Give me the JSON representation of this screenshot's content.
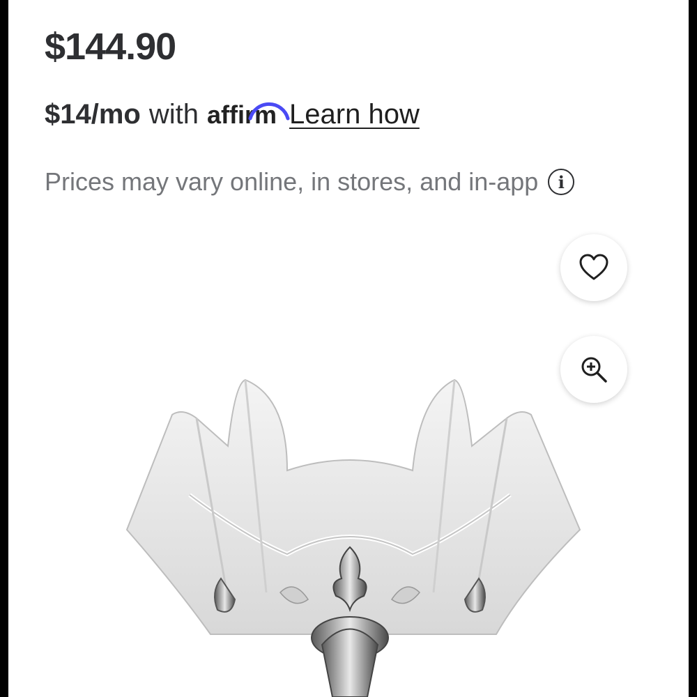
{
  "price": "$144.90",
  "financing": {
    "monthly": "$14/mo",
    "with": "with",
    "provider": "affirm",
    "learn_link": "Learn how"
  },
  "notice": "Prices may vary online, in stores, and in-app",
  "icons": {
    "info": "info-icon",
    "favorite": "heart-icon",
    "zoom": "zoom-in-icon"
  },
  "colors": {
    "text": "#2e2f32",
    "muted": "#74767a",
    "affirm_arc": "#4a4af4"
  }
}
